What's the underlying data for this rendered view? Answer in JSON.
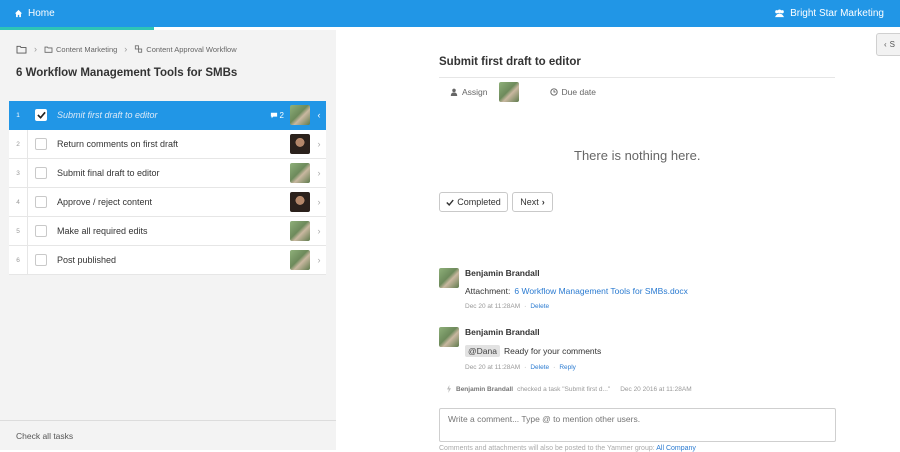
{
  "topbar": {
    "home_label": "Home",
    "org_name": "Bright Star Marketing",
    "home_icon": "home-icon",
    "org_icon": "team-icon"
  },
  "breadcrumb": {
    "project": "Content Marketing",
    "workflow": "Content Approval Workflow"
  },
  "workflow_title": "6 Workflow Management Tools for SMBs",
  "tasks": [
    {
      "num": "1",
      "label": "Submit first draft to editor",
      "checked": true,
      "comments": "2",
      "avatar": "green"
    },
    {
      "num": "2",
      "label": "Return comments on first draft",
      "checked": false,
      "avatar": "dark"
    },
    {
      "num": "3",
      "label": "Submit final draft to editor",
      "checked": false,
      "avatar": "green"
    },
    {
      "num": "4",
      "label": "Approve / reject content",
      "checked": false,
      "avatar": "dark"
    },
    {
      "num": "5",
      "label": "Make all required edits",
      "checked": false,
      "avatar": "green"
    },
    {
      "num": "6",
      "label": "Post published",
      "checked": false,
      "avatar": "green"
    }
  ],
  "check_all_label": "Check all tasks",
  "collapse_label": "S",
  "detail": {
    "title": "Submit first draft to editor",
    "assign_label": "Assign",
    "due_label": "Due date",
    "empty_text": "There is nothing here.",
    "completed_label": "Completed",
    "next_label": "Next"
  },
  "comments": [
    {
      "author": "Benjamin Brandall",
      "prefix": "Attachment:",
      "attachment": "6 Workflow Management Tools for SMBs.docx",
      "time": "Dec 20 at 11:28AM",
      "actions": [
        "Delete"
      ]
    },
    {
      "author": "Benjamin Brandall",
      "mention": "@Dana",
      "text": "Ready for your comments",
      "time": "Dec 20 at 11:28AM",
      "actions": [
        "Delete",
        "Reply"
      ]
    }
  ],
  "activity": {
    "author": "Benjamin Brandall",
    "text": "checked a task \"Submit first d...\"",
    "time": "Dec 20 2016 at 11:28AM"
  },
  "comment_input": {
    "placeholder": "Write a comment... Type @ to mention other users."
  },
  "footnote": {
    "text": "Comments and attachments will also be posted to the Yammer group:",
    "link": "All Company"
  },
  "colors": {
    "primary": "#2196e6",
    "accent": "#2ec4b6",
    "link": "#2b7bd1"
  }
}
